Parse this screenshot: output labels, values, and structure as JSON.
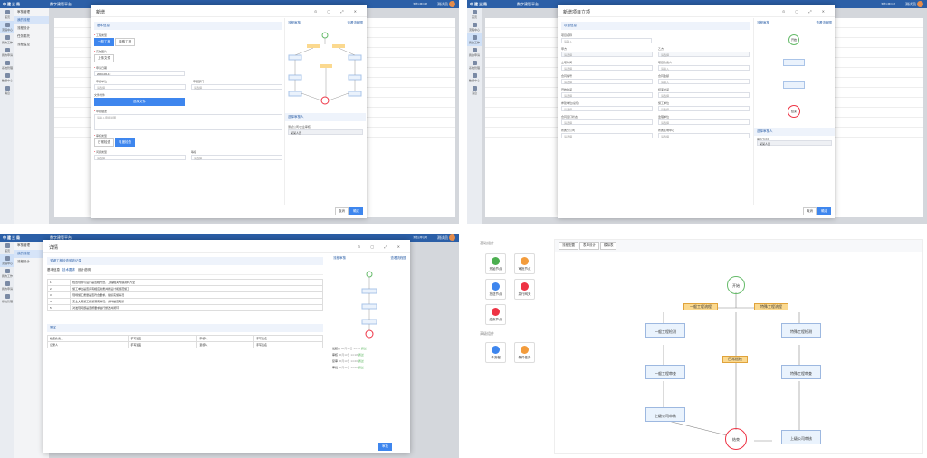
{
  "brand": "中建三局",
  "app": "数字建管平台",
  "node": "测试公司/公司",
  "user": "测试员",
  "nav": [
    "首页",
    "流程中心",
    "我的工作",
    "我的申请",
    "系统管理",
    "数据中心",
    "消息"
  ],
  "q1": {
    "menu": [
      "审核管理",
      "我的流程",
      "流程设计",
      "任务委托",
      "流程监控"
    ],
    "title": "新增",
    "sec1": "基本信息",
    "lbl_type": "工程类型",
    "tab1": "一般工程",
    "tab2": "特殊工程",
    "lbl_img": "实物图片",
    "upload": "上传文件",
    "lbl_date": "申请日期",
    "date": "2023-06-13",
    "lbl_unit": "申报单位",
    "lbl_dept": "申报部门",
    "ph": "请选择",
    "lbl_file": "文件附件",
    "btn_select": "选择文件",
    "lbl_desc": "申报描述",
    "ph_desc": "请输入申报说明",
    "lbl_mode": "审核类型",
    "mode1": "日常检查",
    "mode2": "月度检查",
    "lbl_ptype": "问题类型",
    "lbl_level": "等级",
    "cancel": "取消",
    "ok": "确定",
    "flow_tab": "流程审核",
    "flow_link": "查看流程图",
    "approver_sec": "选择审核人",
    "approver": "测试公司/企业审核",
    "approver_val": "某某人员"
  },
  "q2": {
    "title": "新增项目立项",
    "sec1": "项目信息",
    "f": [
      "项目名称",
      "甲方",
      "乙方",
      "立项时间",
      "项目负责人",
      "合同编号",
      "合同金额",
      "开始时间",
      "结束时间",
      "参建单位(总包)",
      "施工单位",
      "合同签订状态",
      "监理单位",
      "所属分公司",
      "所属区域中心"
    ],
    "ph": "请选择",
    "ph2": "请输入",
    "cancel": "取消",
    "ok": "确定",
    "flow_tab": "流程审核",
    "flow_link": "查看流程图",
    "approver_sec": "选择审核人",
    "approver": "审核节点1",
    "approver_val": "某某人员",
    "start": "开始",
    "end": "结束"
  },
  "q3": {
    "title": "详情",
    "tab1": "基本信息",
    "tab2": "技术要求",
    "tab3": "设计说明",
    "sec": "关键工程检查验收记录",
    "rows": [
      [
        "1",
        "检查现场与设计是否相符合，工程相关内容资料齐全"
      ],
      [
        "2",
        "施工单位是否具有相应资质并按设计和规范施工"
      ],
      [
        "3",
        "现场施工质量是否符合要求，组织实施情况"
      ],
      [
        "4",
        "安全文明施工措施落实情况，资料是否完整"
      ],
      [
        "5",
        "对发现问题是否按要求进行整改并闭环"
      ]
    ],
    "sign_sec": "签字",
    "s1": "检查负责人",
    "s2": "记录人",
    "s3": "审核人",
    "s4": "复核人",
    "sign": "手写签名",
    "btn": "审批",
    "flow_tab": "流程审核",
    "flow_link": "查看流程图",
    "hist": [
      {
        "who": "发起人",
        "when": "06月13日 14:16",
        "tag": "通过"
      },
      {
        "who": "审核",
        "when": "06月13日 14:18",
        "tag": "通过"
      },
      {
        "who": "复审",
        "when": "06月13日 14:20",
        "tag": "通过"
      },
      {
        "who": "审批",
        "when": "06月13日 14:22",
        "tag": "通过"
      }
    ]
  },
  "q4": {
    "palette_sec": "基础组件",
    "palette": [
      {
        "label": "开始节点",
        "color": "#4caf50"
      },
      {
        "label": "审批节点",
        "color": "#f39c3c"
      },
      {
        "label": "抄送节点",
        "color": "#3e86ee"
      },
      {
        "label": "并行网关",
        "color": "#e34"
      },
      {
        "label": "结束节点",
        "color": "#e34"
      }
    ],
    "palette_sec2": "高级组件",
    "palette2": [
      {
        "label": "子流程",
        "color": "#3e86ee"
      },
      {
        "label": "条件任务",
        "color": "#f39c3c"
      }
    ],
    "tabs": [
      "流程配置",
      "表单设计",
      "模拟表"
    ],
    "start": "开始",
    "end": "结束",
    "g1": "一般工程流程",
    "g2": "特殊工程流程",
    "g3": "日常巡检",
    "n1": "一般工程检测",
    "n2": "一般工程审查",
    "n3": "特殊工程检测",
    "n4": "特殊工程审查",
    "n5": "上级公司审核",
    "n6": "上级公司审核"
  }
}
